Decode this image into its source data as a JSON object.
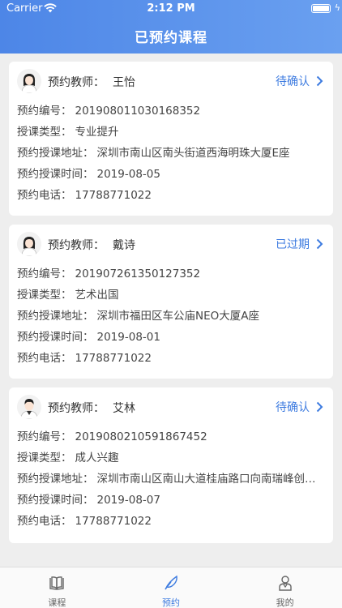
{
  "status_bar": {
    "carrier": "Carrier",
    "time": "2:12 PM"
  },
  "nav": {
    "title": "已预约课程"
  },
  "colors": {
    "accent": "#3d7be0",
    "header_start": "#4d86e7",
    "header_end": "#6aa0f0",
    "background": "#eeeeee"
  },
  "appointments": [
    {
      "teacher_label": "预约教师：",
      "teacher_name": "王怡",
      "status": "待确认",
      "avatar": "female-avatar",
      "rows": [
        {
          "label": "预约编号：",
          "value": "20190801103016835​2"
        },
        {
          "label": "授课类型：",
          "value": "专业提升"
        },
        {
          "label": "预约授课地址：",
          "value": "深圳市南山区南头街道西海明珠大厦E座"
        },
        {
          "label": "预约授课时间：",
          "value": "2019-08-05"
        },
        {
          "label": "预约电话：",
          "value": "17788771022"
        }
      ]
    },
    {
      "teacher_label": "预约教师：",
      "teacher_name": "戴诗",
      "status": "已过期",
      "avatar": "female-avatar",
      "rows": [
        {
          "label": "预约编号：",
          "value": "201907261350127352"
        },
        {
          "label": "授课类型：",
          "value": "艺术出国"
        },
        {
          "label": "预约授课地址：",
          "value": "深圳市福田区车公庙NEO大厦A座"
        },
        {
          "label": "预约授课时间：",
          "value": "2019-08-01"
        },
        {
          "label": "预约电话：",
          "value": "17788771022"
        }
      ]
    },
    {
      "teacher_label": "预约教师：",
      "teacher_name": "艾林",
      "status": "待确认",
      "avatar": "male-avatar",
      "rows": [
        {
          "label": "预约编号：",
          "value": "201908021059186745​2"
        },
        {
          "label": "授课类型：",
          "value": "成人兴趣"
        },
        {
          "label": "预约授课地址：",
          "value": "深圳市南山区南山大道桂庙路口向南瑞峰创业…"
        },
        {
          "label": "预约授课时间：",
          "value": "2019-08-07"
        },
        {
          "label": "预约电话：",
          "value": "17788771022"
        }
      ]
    }
  ],
  "tabs": [
    {
      "label": "课程",
      "icon": "book-icon",
      "active": false
    },
    {
      "label": "预约",
      "icon": "feather-icon",
      "active": true
    },
    {
      "label": "我的",
      "icon": "user-icon",
      "active": false
    }
  ]
}
